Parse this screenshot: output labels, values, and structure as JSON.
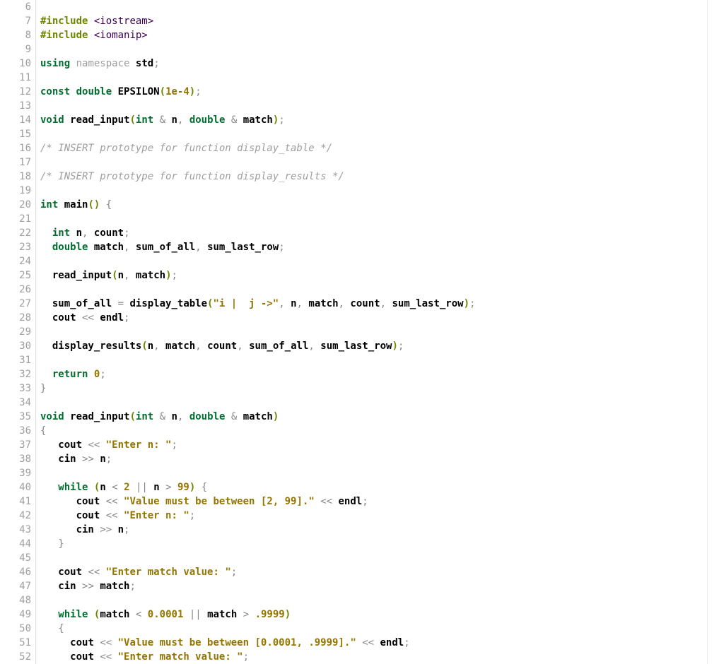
{
  "first_line": 6,
  "lines": [
    {
      "n": 6,
      "html": ""
    },
    {
      "n": 7,
      "html": "<span class='inc'>#include</span> <span class='hdr'>&lt;iostream&gt;</span>"
    },
    {
      "n": 8,
      "html": "<span class='inc'>#include</span> <span class='hdr'>&lt;iomanip&gt;</span>"
    },
    {
      "n": 9,
      "html": ""
    },
    {
      "n": 10,
      "html": "<span class='kw'>using</span> <span class='nsid'>namespace</span> <span class='id'>std</span><span class='punct'>;</span>"
    },
    {
      "n": 11,
      "html": ""
    },
    {
      "n": 12,
      "html": "<span class='kw'>const</span> <span class='kw'>double</span> <span class='id'>EPSILON</span><span class='paren'>(</span><span class='num'>1e-4</span><span class='paren'>)</span><span class='punct'>;</span>"
    },
    {
      "n": 13,
      "html": ""
    },
    {
      "n": 14,
      "html": "<span class='kw'>void</span> <span class='fn'>read_input</span><span class='paren'>(</span><span class='kw'>int</span> <span class='op'>&amp;</span> <span class='id'>n</span><span class='punct'>,</span> <span class='kw'>double</span> <span class='op'>&amp;</span> <span class='id'>match</span><span class='paren'>)</span><span class='punct'>;</span>"
    },
    {
      "n": 15,
      "html": ""
    },
    {
      "n": 16,
      "html": "<span class='cmt'>/* INSERT prototype for function display_table */</span>"
    },
    {
      "n": 17,
      "html": ""
    },
    {
      "n": 18,
      "html": "<span class='cmt'>/* INSERT prototype for function display_results */</span>"
    },
    {
      "n": 19,
      "html": ""
    },
    {
      "n": 20,
      "html": "<span class='kw'>int</span> <span class='fn'>main</span><span class='paren'>()</span> <span class='brace'>{</span>"
    },
    {
      "n": 21,
      "html": ""
    },
    {
      "n": 22,
      "html": "  <span class='kw'>int</span> <span class='id'>n</span><span class='punct'>,</span> <span class='id'>count</span><span class='punct'>;</span>"
    },
    {
      "n": 23,
      "html": "  <span class='kw'>double</span> <span class='id'>match</span><span class='punct'>,</span> <span class='id'>sum_of_all</span><span class='punct'>,</span> <span class='id'>sum_last_row</span><span class='punct'>;</span>"
    },
    {
      "n": 24,
      "html": ""
    },
    {
      "n": 25,
      "html": "  <span class='fn'>read_input</span><span class='paren'>(</span><span class='id'>n</span><span class='punct'>,</span> <span class='id'>match</span><span class='paren'>)</span><span class='punct'>;</span>"
    },
    {
      "n": 26,
      "html": ""
    },
    {
      "n": 27,
      "html": "  <span class='id'>sum_of_all</span> <span class='op'>=</span> <span class='fn'>display_table</span><span class='paren'>(</span><span class='str'>\"i |  j -&gt;\"</span><span class='punct'>,</span> <span class='id'>n</span><span class='punct'>,</span> <span class='id'>match</span><span class='punct'>,</span> <span class='id'>count</span><span class='punct'>,</span> <span class='id'>sum_last_row</span><span class='paren'>)</span><span class='punct'>;</span>"
    },
    {
      "n": 28,
      "html": "  <span class='id'>cout</span> <span class='op'>&lt;&lt;</span> <span class='id'>endl</span><span class='punct'>;</span>"
    },
    {
      "n": 29,
      "html": ""
    },
    {
      "n": 30,
      "html": "  <span class='fn'>display_results</span><span class='paren'>(</span><span class='id'>n</span><span class='punct'>,</span> <span class='id'>match</span><span class='punct'>,</span> <span class='id'>count</span><span class='punct'>,</span> <span class='id'>sum_of_all</span><span class='punct'>,</span> <span class='id'>sum_last_row</span><span class='paren'>)</span><span class='punct'>;</span>"
    },
    {
      "n": 31,
      "html": ""
    },
    {
      "n": 32,
      "html": "  <span class='kw'>return</span> <span class='num'>0</span><span class='punct'>;</span>"
    },
    {
      "n": 33,
      "html": "<span class='brace'>}</span>"
    },
    {
      "n": 34,
      "html": ""
    },
    {
      "n": 35,
      "html": "<span class='kw'>void</span> <span class='fn'>read_input</span><span class='paren'>(</span><span class='kw'>int</span> <span class='op'>&amp;</span> <span class='id'>n</span><span class='punct'>,</span> <span class='kw'>double</span> <span class='op'>&amp;</span> <span class='id'>match</span><span class='paren'>)</span>"
    },
    {
      "n": 36,
      "html": "<span class='brace'>{</span>"
    },
    {
      "n": 37,
      "html": "   <span class='id'>cout</span> <span class='op'>&lt;&lt;</span> <span class='str'>\"Enter n: \"</span><span class='punct'>;</span>"
    },
    {
      "n": 38,
      "html": "   <span class='id'>cin</span> <span class='op'>&gt;&gt;</span> <span class='id'>n</span><span class='punct'>;</span>"
    },
    {
      "n": 39,
      "html": ""
    },
    {
      "n": 40,
      "html": "   <span class='kw'>while</span> <span class='paren'>(</span><span class='id'>n</span> <span class='op'>&lt;</span> <span class='num'>2</span> <span class='op'>||</span> <span class='id'>n</span> <span class='op'>&gt;</span> <span class='num'>99</span><span class='paren'>)</span> <span class='brace'>{</span>"
    },
    {
      "n": 41,
      "html": "      <span class='id'>cout</span> <span class='op'>&lt;&lt;</span> <span class='str'>\"Value must be between [2, 99].\"</span> <span class='op'>&lt;&lt;</span> <span class='id'>endl</span><span class='punct'>;</span>"
    },
    {
      "n": 42,
      "html": "      <span class='id'>cout</span> <span class='op'>&lt;&lt;</span> <span class='str'>\"Enter n: \"</span><span class='punct'>;</span>"
    },
    {
      "n": 43,
      "html": "      <span class='id'>cin</span> <span class='op'>&gt;&gt;</span> <span class='id'>n</span><span class='punct'>;</span>"
    },
    {
      "n": 44,
      "html": "   <span class='brace'>}</span>"
    },
    {
      "n": 45,
      "html": ""
    },
    {
      "n": 46,
      "html": "   <span class='id'>cout</span> <span class='op'>&lt;&lt;</span> <span class='str'>\"Enter match value: \"</span><span class='punct'>;</span>"
    },
    {
      "n": 47,
      "html": "   <span class='id'>cin</span> <span class='op'>&gt;&gt;</span> <span class='id'>match</span><span class='punct'>;</span>"
    },
    {
      "n": 48,
      "html": ""
    },
    {
      "n": 49,
      "html": "   <span class='kw'>while</span> <span class='paren'>(</span><span class='id'>match</span> <span class='op'>&lt;</span> <span class='num'>0.0001</span> <span class='op'>||</span> <span class='id'>match</span> <span class='op'>&gt;</span> <span class='num'>.9999</span><span class='paren'>)</span>"
    },
    {
      "n": 50,
      "html": "   <span class='brace'>{</span>"
    },
    {
      "n": 51,
      "html": "     <span class='id'>cout</span> <span class='op'>&lt;&lt;</span> <span class='str'>\"Value must be between [0.0001, .9999].\"</span> <span class='op'>&lt;&lt;</span> <span class='id'>endl</span><span class='punct'>;</span>"
    },
    {
      "n": 52,
      "html": "     <span class='id'>cout</span> <span class='op'>&lt;&lt;</span> <span class='str'>\"Enter match value: \"</span><span class='punct'>;</span>"
    }
  ]
}
